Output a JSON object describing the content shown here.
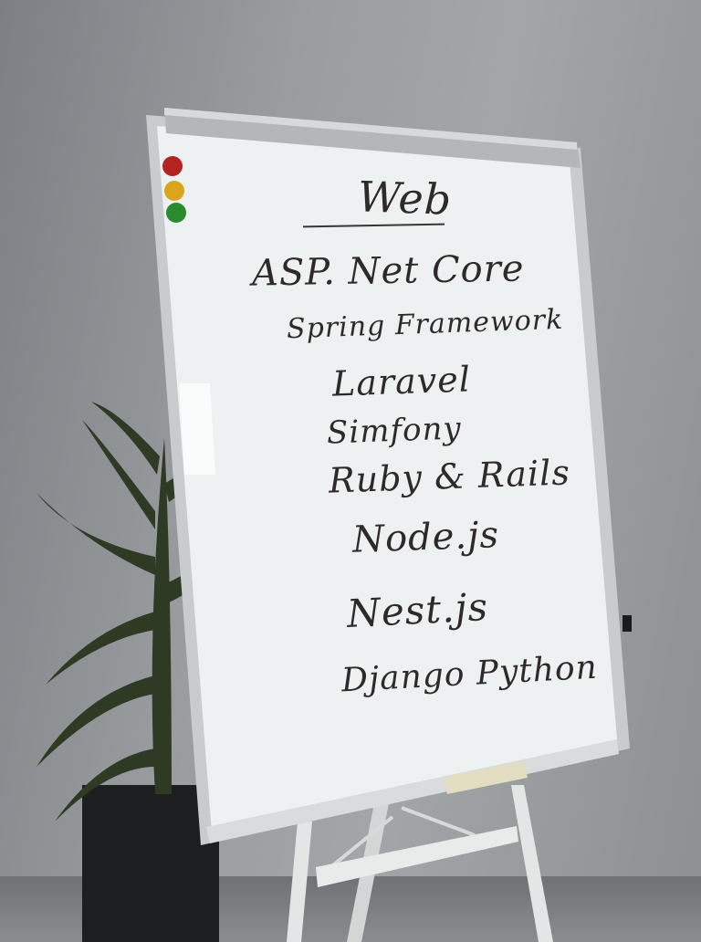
{
  "whiteboard": {
    "heading": "Web",
    "items": [
      "ASP. Net Core",
      "Spring Framework",
      "Laravel",
      "Simfony",
      "Ruby & Rails",
      "Node.js",
      "Nest.js",
      "Django Python"
    ]
  },
  "magnets": {
    "colors": [
      "#b3231f",
      "#d9a51d",
      "#2a8a2e"
    ]
  }
}
